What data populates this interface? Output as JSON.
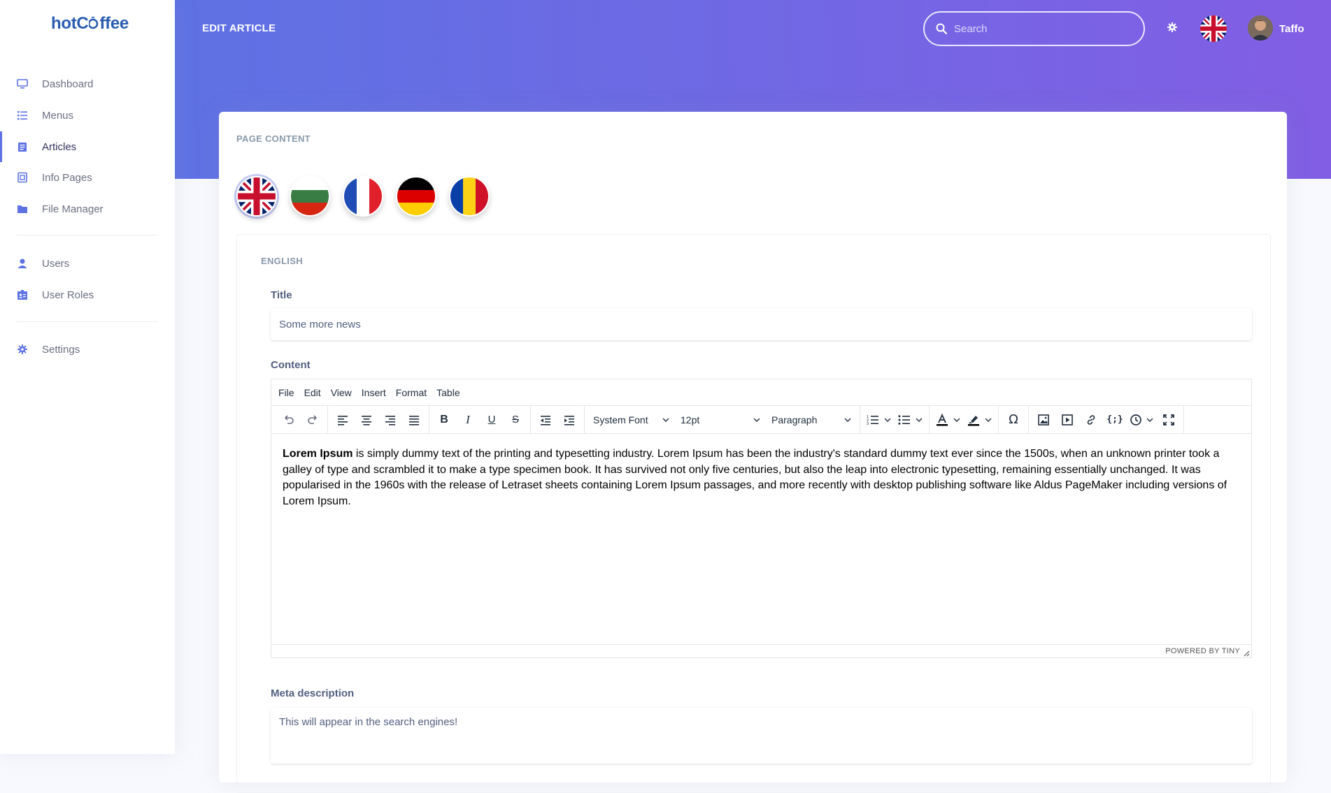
{
  "brand": {
    "name_part1": "hotC",
    "name_part2": "ffee"
  },
  "sidebar": {
    "items": [
      {
        "label": "Dashboard",
        "icon": "monitor-icon"
      },
      {
        "label": "Menus",
        "icon": "list-icon"
      },
      {
        "label": "Articles",
        "icon": "article-icon",
        "active": true
      },
      {
        "label": "Info Pages",
        "icon": "info-page-icon"
      },
      {
        "label": "File Manager",
        "icon": "folder-icon"
      },
      {
        "label": "Users",
        "icon": "user-icon"
      },
      {
        "label": "User Roles",
        "icon": "id-badge-icon"
      },
      {
        "label": "Settings",
        "icon": "gear-icon"
      }
    ]
  },
  "header": {
    "title": "EDIT ARTICLE",
    "search_placeholder": "Search",
    "username": "Taffo"
  },
  "colors": {
    "accent": "#5e72e4",
    "gradient_end": "#825ee4",
    "icon": "#5e72e4"
  },
  "page": {
    "section_label": "PAGE CONTENT",
    "languages": [
      "English (UK)",
      "Bulgarian",
      "French",
      "German",
      "Romanian"
    ],
    "current_language_label": "ENGLISH",
    "title_label": "Title",
    "title_value": "Some more news",
    "content_label": "Content",
    "meta_label": "Meta description",
    "meta_value": "This will appear in the search engines!"
  },
  "editor": {
    "menu": [
      "File",
      "Edit",
      "View",
      "Insert",
      "Format",
      "Table"
    ],
    "font_family": "System Font",
    "font_size": "12pt",
    "block_format": "Paragraph",
    "body_bold": "Lorem Ipsum",
    "body_text": " is simply dummy text of the printing and typesetting industry. Lorem Ipsum has been the industry's standard dummy text ever since the 1500s, when an unknown printer took a galley of type and scrambled it to make a type specimen book. It has survived not only five centuries, but also the leap into electronic typesetting, remaining essentially unchanged. It was popularised in the 1960s with the release of Letraset sheets containing Lorem Ipsum passages, and more recently with desktop publishing software like Aldus PageMaker including versions of Lorem Ipsum.",
    "powered_by": "POWERED BY TINY"
  }
}
